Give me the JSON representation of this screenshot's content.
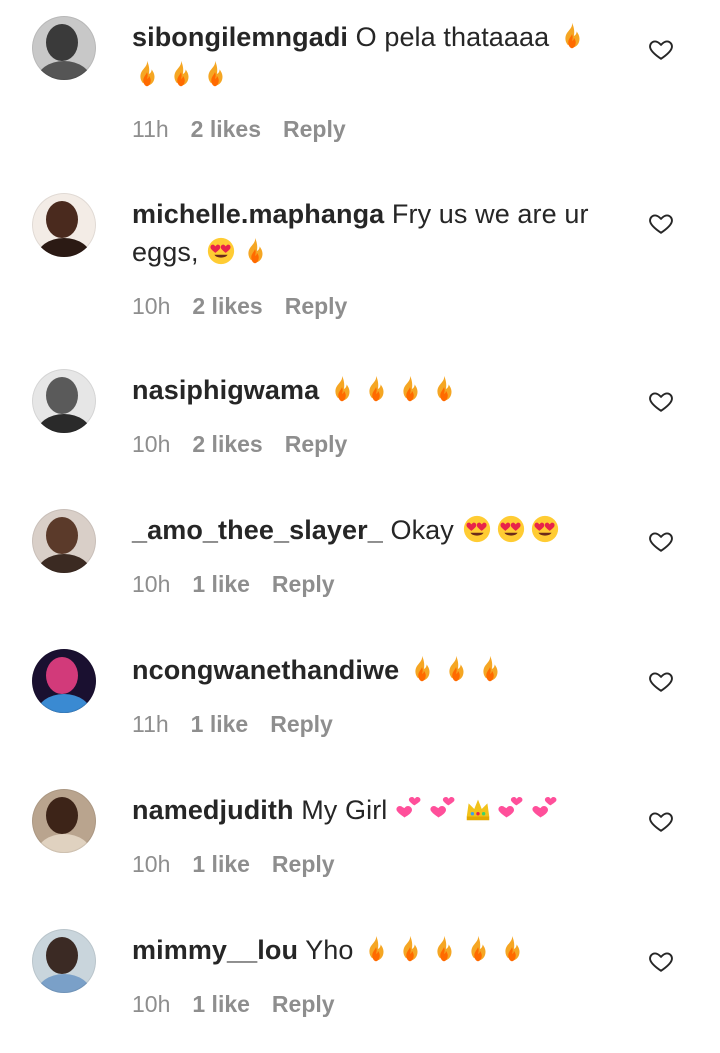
{
  "comments": [
    {
      "username": "sibongilemngadi",
      "text": "O pela thataaaa",
      "emojis": [
        "fire",
        "fire",
        "fire",
        "fire"
      ],
      "time": "11h",
      "likes": "2 likes",
      "reply": "Reply",
      "avatar_colors": {
        "bg": "#c8c8c8",
        "face": "#3a3a3a",
        "body": "#555555"
      }
    },
    {
      "username": "michelle.maphanga",
      "text": "Fry us we are ur eggs,",
      "emojis": [
        "heart-eyes",
        "fire"
      ],
      "time": "10h",
      "likes": "2 likes",
      "reply": "Reply",
      "avatar_colors": {
        "bg": "#f3ece6",
        "face": "#4a2a1e",
        "body": "#2b1a14"
      }
    },
    {
      "username": "nasiphigwama",
      "text": "",
      "emojis": [
        "fire",
        "fire",
        "fire",
        "fire"
      ],
      "time": "10h",
      "likes": "2 likes",
      "reply": "Reply",
      "avatar_colors": {
        "bg": "#e6e6e6",
        "face": "#5a5a5a",
        "body": "#2a2a2a"
      }
    },
    {
      "username": "_amo_thee_slayer_",
      "text": "Okay",
      "emojis": [
        "heart-eyes",
        "heart-eyes",
        "heart-eyes"
      ],
      "time": "10h",
      "likes": "1 like",
      "reply": "Reply",
      "avatar_colors": {
        "bg": "#d9cfc8",
        "face": "#5b3a2a",
        "body": "#3b2a22"
      }
    },
    {
      "username": "ncongwanethandiwe",
      "text": "",
      "emojis": [
        "fire",
        "fire",
        "fire"
      ],
      "time": "11h",
      "likes": "1 like",
      "reply": "Reply",
      "avatar_colors": {
        "bg": "#1a1030",
        "face": "#d23a7a",
        "body": "#3a8ad2"
      }
    },
    {
      "username": "namedjudith",
      "text": "My Girl",
      "emojis": [
        "two-hearts",
        "two-hearts",
        "crown",
        "two-hearts",
        "two-hearts"
      ],
      "time": "10h",
      "likes": "1 like",
      "reply": "Reply",
      "avatar_colors": {
        "bg": "#b9a48e",
        "face": "#3d2418",
        "body": "#e0d2c0"
      }
    },
    {
      "username": "mimmy__lou",
      "text": "Yho",
      "emojis": [
        "fire",
        "fire",
        "fire",
        "fire",
        "fire"
      ],
      "time": "10h",
      "likes": "1 like",
      "reply": "Reply",
      "avatar_colors": {
        "bg": "#c9d5dc",
        "face": "#3b2a24",
        "body": "#7aa0c8"
      }
    }
  ],
  "colors": {
    "text": "#262626",
    "meta": "#8e8e8e",
    "fire_outer": "#f5a623",
    "fire_inner": "#ff6a00",
    "heart_pink": "#ff4f9a"
  },
  "icons": {
    "like": "heart-outline-icon"
  }
}
